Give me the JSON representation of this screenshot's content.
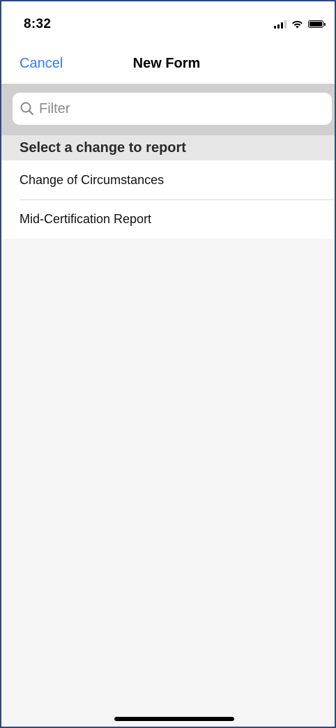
{
  "status_bar": {
    "time": "8:32",
    "icons": [
      "signal-icon",
      "wifi-icon",
      "battery-icon"
    ]
  },
  "nav": {
    "cancel_label": "Cancel",
    "title": "New Form",
    "accent_color": "#2f7cf6"
  },
  "search": {
    "placeholder": "Filter",
    "value": "",
    "icon": "search-icon"
  },
  "section": {
    "header": "Select a change to report"
  },
  "list": {
    "items": [
      {
        "label": "Change of Circumstances"
      },
      {
        "label": "Mid-Certification Report"
      }
    ]
  }
}
